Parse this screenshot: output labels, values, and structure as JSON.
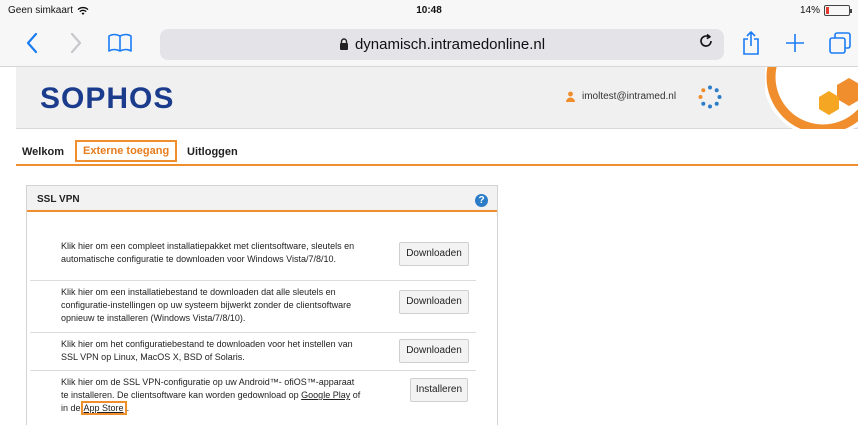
{
  "status_bar": {
    "carrier": "Geen simkaart",
    "time": "10:48",
    "battery": "14%",
    "battery_level": 0.14
  },
  "browser": {
    "url": "dynamisch.intramedonline.nl"
  },
  "header": {
    "logo": "SOPHOS",
    "user": "imoltest@intramed.nl"
  },
  "nav": {
    "items": [
      "Welkom",
      "Externe toegang",
      "Uitloggen"
    ],
    "active": "Externe toegang"
  },
  "panel": {
    "title": "SSL VPN",
    "rows": [
      {
        "text": "Klik hier om een compleet installatiepakket met clientsoftware, sleutels en automatische configuratie te downloaden voor Windows Vista/7/8/10.",
        "button": "Downloaden"
      },
      {
        "text": "Klik hier om een installatiebestand te downloaden dat alle sleutels en configuratie-instellingen op uw systeem bijwerkt zonder de clientsoftware opnieuw te installeren (Windows Vista/7/8/10).",
        "button": "Downloaden"
      },
      {
        "text": "Klik hier om het configuratiebestand te downloaden voor het instellen van SSL VPN op Linux, MacOS X, BSD of Solaris.",
        "button": "Downloaden"
      },
      {
        "text_before": "Klik hier om de SSL VPN-configuratie op uw Android™- ofiOS™-apparaat te installeren. De clientsoftware kan worden gedownload op",
        "google_play": "Google Play",
        "text_middle": "of in de",
        "app_store": "App Store",
        "text_after": ".",
        "button": "Installeren"
      }
    ]
  },
  "colors": {
    "accent": "#f08d2c",
    "brand": "#1b3b8c",
    "ios_blue": "#1a7cf5",
    "help": "#2c7dc8"
  }
}
